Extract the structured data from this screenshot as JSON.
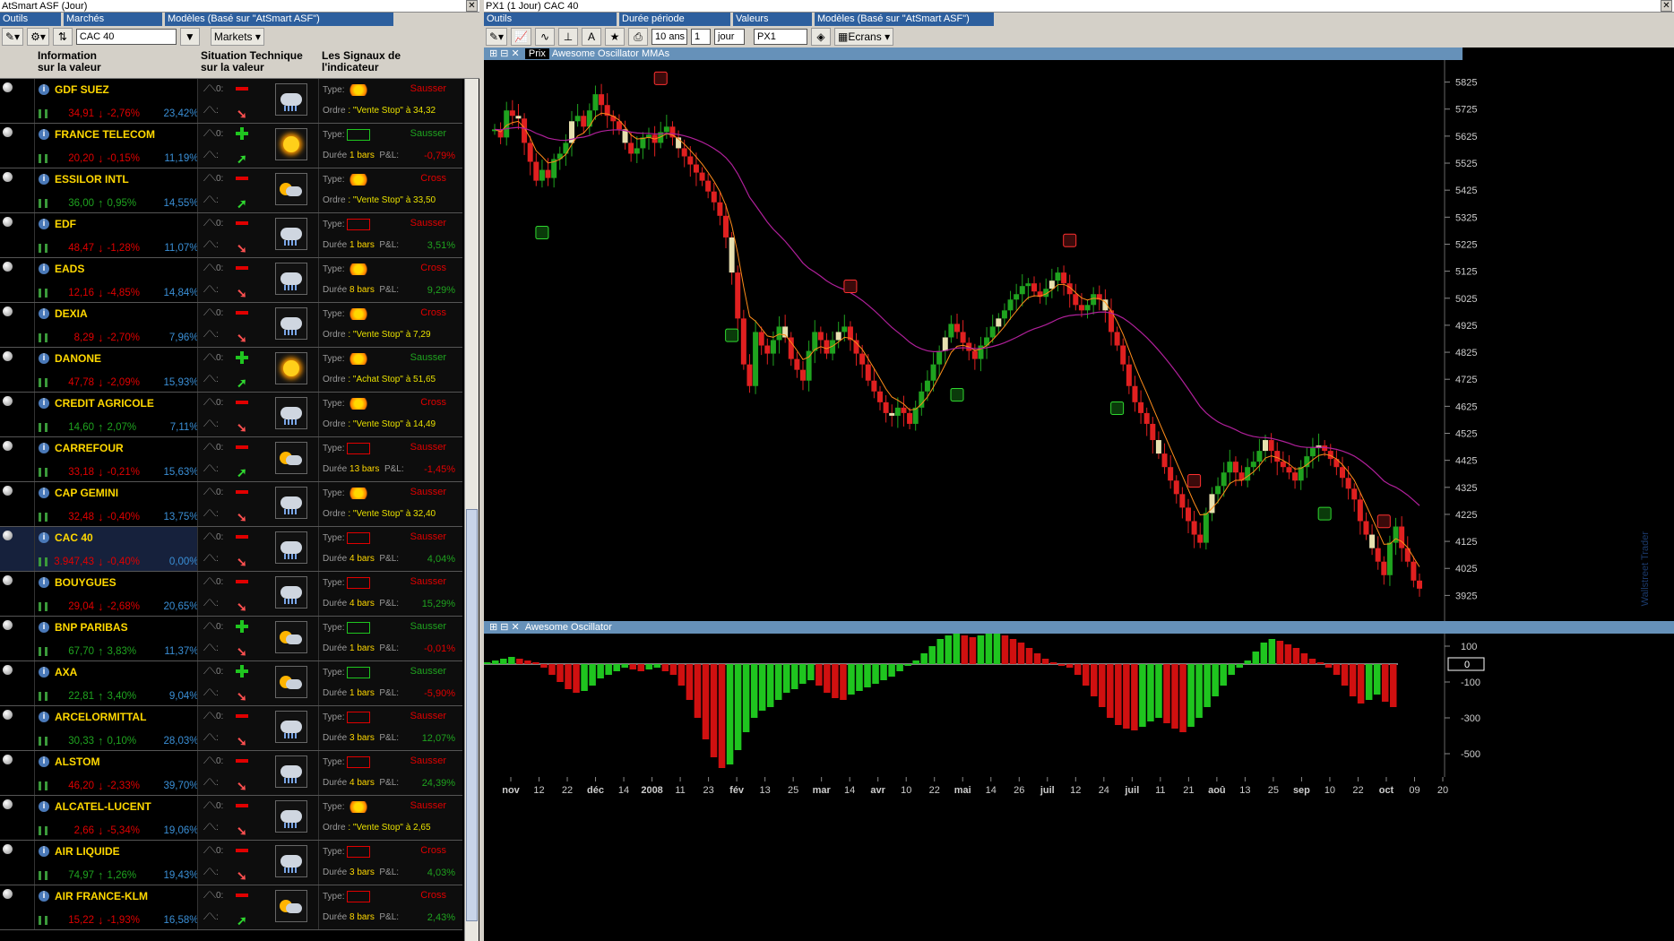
{
  "left": {
    "title": "AtSmart ASF (Jour)",
    "tabs": {
      "outils": "Outils",
      "marches": "Marchés",
      "modeles": "Modèles (Basé sur \"AtSmart ASF\")"
    },
    "market_input": "CAC 40",
    "markets_label": "Markets",
    "columns": {
      "info1": "Information",
      "info2": "sur la valeur",
      "tech1": "Situation Technique",
      "tech2": "sur la valeur",
      "sig1": "Les Signaux de",
      "sig2": "l'indicateur"
    },
    "rows": [
      {
        "name": "GDF SUEZ",
        "price": "34,91",
        "chg": "-2,76%",
        "vol": "23,42%",
        "up": false,
        "tech": "minus",
        "tarr": "dn",
        "weather": "cloud",
        "status": "Sausser",
        "sg": false,
        "line2k": "Ordre",
        "line2": ": \"Vente Stop\" à 34,32",
        "pl": "",
        "star": true
      },
      {
        "name": "FRANCE TELECOM",
        "price": "20,20",
        "chg": "-0,15%",
        "vol": "11,19%",
        "up": false,
        "tech": "plus",
        "tarr": "up",
        "weather": "sun",
        "status": "Sausser",
        "sg": true,
        "line2k": "Durée",
        "line2": "1 bars",
        "pl": "-0,79%",
        "star": false
      },
      {
        "name": "ESSILOR INTL",
        "price": "36,00",
        "chg": "0,95%",
        "vol": "14,55%",
        "up": true,
        "tech": "minus",
        "tarr": "up",
        "weather": "mix",
        "status": "Cross",
        "sg": false,
        "line2k": "Ordre",
        "line2": ": \"Vente Stop\" à 33,50",
        "pl": "",
        "star": true
      },
      {
        "name": "EDF",
        "price": "48,47",
        "chg": "-1,28%",
        "vol": "11,07%",
        "up": false,
        "tech": "minus",
        "tarr": "dn",
        "weather": "cloud",
        "status": "Sausser",
        "sg": false,
        "line2k": "Durée",
        "line2": "1 bars",
        "pl": "3,51%",
        "star": false
      },
      {
        "name": "EADS",
        "price": "12,16",
        "chg": "-4,85%",
        "vol": "14,84%",
        "up": false,
        "tech": "minus",
        "tarr": "dn",
        "weather": "cloud",
        "status": "Cross",
        "sg": false,
        "line2k": "Durée",
        "line2": "8 bars",
        "pl": "9,29%",
        "star": true
      },
      {
        "name": "DEXIA",
        "price": "8,29",
        "chg": "-2,70%",
        "vol": "7,96%",
        "up": false,
        "tech": "minus",
        "tarr": "dn",
        "weather": "cloud",
        "status": "Cross",
        "sg": false,
        "line2k": "Ordre",
        "line2": ": \"Vente Stop\" à 7,29",
        "pl": "",
        "star": true
      },
      {
        "name": "DANONE",
        "price": "47,78",
        "chg": "-2,09%",
        "vol": "15,93%",
        "up": false,
        "tech": "plus",
        "tarr": "up",
        "weather": "sun",
        "status": "Sausser",
        "sg": true,
        "line2k": "Ordre",
        "line2": ": \"Achat Stop\" à 51,65",
        "pl": "",
        "star": true
      },
      {
        "name": "CREDIT AGRICOLE",
        "price": "14,60",
        "chg": "2,07%",
        "vol": "7,11%",
        "up": true,
        "tech": "minus",
        "tarr": "dn",
        "weather": "cloud",
        "status": "Cross",
        "sg": false,
        "line2k": "Ordre",
        "line2": ": \"Vente Stop\" à 14,49",
        "pl": "",
        "star": true
      },
      {
        "name": "CARREFOUR",
        "price": "33,18",
        "chg": "-0,21%",
        "vol": "15,63%",
        "up": false,
        "tech": "minus",
        "tarr": "up",
        "weather": "mix",
        "status": "Sausser",
        "sg": false,
        "line2k": "Durée",
        "line2": "13 bars",
        "pl": "-1,45%",
        "star": false
      },
      {
        "name": "CAP GEMINI",
        "price": "32,48",
        "chg": "-0,40%",
        "vol": "13,75%",
        "up": false,
        "tech": "minus",
        "tarr": "dn",
        "weather": "cloud",
        "status": "Sausser",
        "sg": false,
        "line2k": "Ordre",
        "line2": ": \"Vente Stop\" à 32,40",
        "pl": "",
        "star": true
      },
      {
        "name": "CAC 40",
        "price": "3.947,43",
        "chg": "-0,40%",
        "vol": "0,00%",
        "up": false,
        "tech": "minus",
        "tarr": "dn",
        "weather": "cloud",
        "status": "Sausser",
        "sg": false,
        "line2k": "Durée",
        "line2": "4 bars",
        "pl": "4,04%",
        "star": false,
        "sel": true
      },
      {
        "name": "BOUYGUES",
        "price": "29,04",
        "chg": "-2,68%",
        "vol": "20,65%",
        "up": false,
        "tech": "minus",
        "tarr": "dn",
        "weather": "cloud",
        "status": "Sausser",
        "sg": false,
        "line2k": "Durée",
        "line2": "4 bars",
        "pl": "15,29%",
        "star": false
      },
      {
        "name": "BNP PARIBAS",
        "price": "67,70",
        "chg": "3,83%",
        "vol": "11,37%",
        "up": true,
        "tech": "plus",
        "tarr": "dn",
        "weather": "mix",
        "status": "Sausser",
        "sg": true,
        "line2k": "Durée",
        "line2": "1 bars",
        "pl": "-0,01%",
        "star": false
      },
      {
        "name": "AXA",
        "price": "22,81",
        "chg": "3,40%",
        "vol": "9,04%",
        "up": true,
        "tech": "plus",
        "tarr": "dn",
        "weather": "mix",
        "status": "Sausser",
        "sg": true,
        "line2k": "Durée",
        "line2": "1 bars",
        "pl": "-5,90%",
        "star": false
      },
      {
        "name": "ARCELORMITTAL",
        "price": "30,33",
        "chg": "0,10%",
        "vol": "28,03%",
        "up": true,
        "tech": "minus",
        "tarr": "dn",
        "weather": "cloud",
        "status": "Sausser",
        "sg": false,
        "line2k": "Durée",
        "line2": "3 bars",
        "pl": "12,07%",
        "star": false
      },
      {
        "name": "ALSTOM",
        "price": "46,20",
        "chg": "-2,33%",
        "vol": "39,70%",
        "up": false,
        "tech": "minus",
        "tarr": "dn",
        "weather": "cloud",
        "status": "Sausser",
        "sg": false,
        "line2k": "Durée",
        "line2": "4 bars",
        "pl": "24,39%",
        "star": false
      },
      {
        "name": "ALCATEL-LUCENT",
        "price": "2,66",
        "chg": "-5,34%",
        "vol": "19,06%",
        "up": false,
        "tech": "minus",
        "tarr": "dn",
        "weather": "cloud",
        "status": "Sausser",
        "sg": false,
        "line2k": "Ordre",
        "line2": ": \"Vente Stop\" à 2,65",
        "pl": "",
        "star": true
      },
      {
        "name": "AIR LIQUIDE",
        "price": "74,97",
        "chg": "1,26%",
        "vol": "19,43%",
        "up": true,
        "tech": "minus",
        "tarr": "dn",
        "weather": "cloud",
        "status": "Cross",
        "sg": false,
        "line2k": "Durée",
        "line2": "3 bars",
        "pl": "4,03%",
        "star": false
      },
      {
        "name": "AIR FRANCE-KLM",
        "price": "15,22",
        "chg": "-1,93%",
        "vol": "16,58%",
        "up": false,
        "tech": "minus",
        "tarr": "up",
        "weather": "mix",
        "status": "Cross",
        "sg": false,
        "line2k": "Durée",
        "line2": "8 bars",
        "pl": "2,43%",
        "star": false
      }
    ],
    "labels": {
      "type": "Type",
      "pl": "P&L:"
    }
  },
  "right": {
    "title": "PX1 (1 Jour) CAC 40",
    "tabs": {
      "outils": "Outils",
      "duree": "Durée  période",
      "valeurs": "Valeurs",
      "modeles": "Modèles (Basé sur \"AtSmart ASF\")"
    },
    "period_value": "10 ans",
    "period_n": "1",
    "period_unit": "jour",
    "symbol": "PX1",
    "ecrans": "Ecrans",
    "price_panel": {
      "tab": "Prix",
      "legend": "Awesome Oscillator MMAs"
    },
    "osc_panel": {
      "title": "Awesome Oscillator",
      "zero_box": "0"
    },
    "watermark": "Wallstreet Trader"
  },
  "chart_data": {
    "type": "candlestick",
    "x_labels": [
      "nov",
      "12",
      "22",
      "déc",
      "14",
      "2008",
      "11",
      "23",
      "fév",
      "13",
      "25",
      "mar",
      "14",
      "avr",
      "10",
      "22",
      "mai",
      "14",
      "26",
      "juil",
      "12",
      "24",
      "juil",
      "11",
      "21",
      "aoû",
      "13",
      "25",
      "sep",
      "10",
      "22",
      "oct",
      "09",
      "20"
    ],
    "price_ticks": [
      5825,
      5725,
      5625,
      5525,
      5425,
      5325,
      5225,
      5125,
      5025,
      4925,
      4825,
      4725,
      4625,
      4525,
      4425,
      4325,
      4225,
      4125,
      4025,
      3925
    ],
    "osc_ticks": [
      100,
      -100,
      -300,
      -500
    ],
    "ylim_price": [
      3850,
      5880
    ],
    "closes": [
      5650,
      5620,
      5720,
      5700,
      5690,
      5600,
      5530,
      5460,
      5500,
      5470,
      5540,
      5560,
      5600,
      5680,
      5700,
      5660,
      5720,
      5780,
      5740,
      5700,
      5680,
      5650,
      5600,
      5560,
      5580,
      5620,
      5630,
      5600,
      5640,
      5660,
      5620,
      5580,
      5550,
      5520,
      5490,
      5460,
      5420,
      5380,
      5330,
      5250,
      5120,
      4950,
      4780,
      4700,
      4900,
      4850,
      4820,
      4870,
      4920,
      4880,
      4800,
      4760,
      4720,
      4830,
      4900,
      4870,
      4820,
      4870,
      4900,
      4920,
      4870,
      4820,
      4780,
      4720,
      4680,
      4640,
      4600,
      4590,
      4620,
      4600,
      4560,
      4620,
      4680,
      4720,
      4780,
      4830,
      4880,
      4930,
      4900,
      4860,
      4830,
      4800,
      4850,
      4880,
      4920,
      4950,
      4980,
      5020,
      5040,
      5070,
      5080,
      5050,
      5030,
      5060,
      5090,
      5120,
      5080,
      5040,
      5000,
      4980,
      5000,
      5040,
      5020,
      4980,
      4900,
      4850,
      4780,
      4700,
      4640,
      4600,
      4560,
      4500,
      4450,
      4400,
      4350,
      4300,
      4250,
      4200,
      4150,
      4120,
      4230,
      4300,
      4330,
      4380,
      4420,
      4380,
      4350,
      4400,
      4420,
      4460,
      4500,
      4460,
      4420,
      4400,
      4380,
      4350,
      4400,
      4440,
      4470,
      4480,
      4460,
      4430,
      4400,
      4360,
      4320,
      4280,
      4200,
      4150,
      4100,
      4050,
      4000,
      4120,
      4180,
      4100,
      4050,
      3980,
      3950
    ],
    "ao": [
      10,
      20,
      30,
      40,
      30,
      20,
      10,
      -20,
      -60,
      -100,
      -140,
      -160,
      -150,
      -120,
      -80,
      -60,
      -40,
      -20,
      -30,
      -40,
      -30,
      -20,
      -40,
      -60,
      -120,
      -200,
      -300,
      -420,
      -520,
      -580,
      -560,
      -480,
      -380,
      -300,
      -260,
      -240,
      -200,
      -160,
      -140,
      -110,
      -90,
      -120,
      -160,
      -190,
      -200,
      -170,
      -150,
      -130,
      -110,
      -90,
      -70,
      -40,
      -10,
      20,
      60,
      100,
      140,
      160,
      170,
      160,
      150,
      160,
      170,
      180,
      160,
      140,
      120,
      90,
      60,
      30,
      10,
      -10,
      -20,
      -60,
      -120,
      -180,
      -240,
      -300,
      -340,
      -360,
      -370,
      -350,
      -320,
      -300,
      -330,
      -360,
      -380,
      -350,
      -300,
      -240,
      -180,
      -120,
      -60,
      -20,
      20,
      70,
      120,
      140,
      130,
      110,
      90,
      60,
      30,
      10,
      -20,
      -60,
      -120,
      -180,
      -220,
      -200,
      -170,
      -210,
      -240
    ]
  }
}
